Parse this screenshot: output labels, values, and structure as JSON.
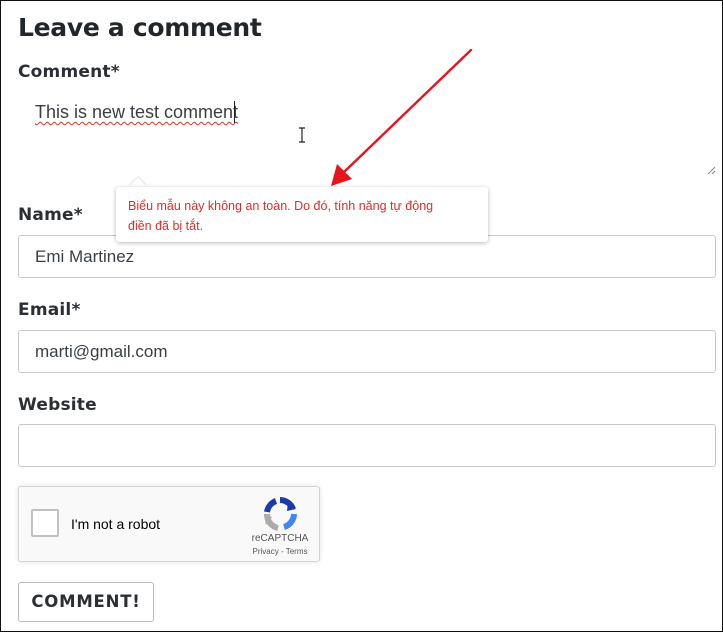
{
  "form": {
    "heading": "Leave a comment",
    "comment_label": "Comment*",
    "comment_value": "This is new test comment",
    "name_label": "Name*",
    "name_value": "Emi Martinez",
    "email_label": "Email*",
    "email_value": "marti@gmail.com",
    "website_label": "Website",
    "website_value": "",
    "submit_label": "COMMENT!"
  },
  "tooltip": {
    "line1": "Biểu mẫu này không an toàn. Do đó, tính năng tự động",
    "line2": "điền đã bị tắt."
  },
  "recaptcha": {
    "checkbox_label": "I'm not a robot",
    "brand": "reCAPTCHA",
    "privacy": "Privacy",
    "separator": " - ",
    "terms": "Terms"
  },
  "colors": {
    "annotation_arrow": "#e8141b",
    "tooltip_text": "#d93025",
    "text": "#2b2f33"
  },
  "icons": {
    "cursor": "ibeam-cursor-icon",
    "recaptcha": "recaptcha-logo-icon",
    "resize": "resize-handle-icon"
  }
}
